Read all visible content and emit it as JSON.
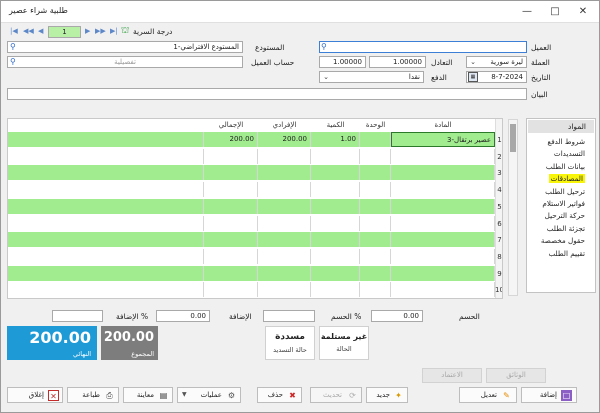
{
  "window": {
    "title": "طلبية شراء عصير"
  },
  "nav": {
    "page": "1",
    "approval_label": "درجة السرية"
  },
  "header": {
    "customer_label": "العميل",
    "customer_value": "",
    "warehouse_label": "المستودع",
    "warehouse_value": "1-المستودع الافتراضي",
    "currency_label": "العملة",
    "currency_value": "ليرة سورية",
    "rate_label": "التعادل",
    "rate_value": "1.00000",
    "rate_value2": "1.00000",
    "customer_account_label": "حساب العميل",
    "customer_account_placeholder": "تفصيلية",
    "date_label": "التاريخ",
    "date_value": "8-7-2024",
    "payment_label": "الدفع",
    "payment_value": "نقدا",
    "statement_label": "البيان",
    "statement_value": ""
  },
  "grid": {
    "columns": [
      "المادة",
      "الوحدة",
      "الكمية",
      "الإفرادي",
      "الإجمالي"
    ],
    "rows": [
      {
        "num": "1",
        "item": "3-عصير برتقال",
        "unit": "",
        "qty": "1.00",
        "price": "200.00",
        "total": "200.00"
      },
      {
        "num": "2"
      },
      {
        "num": "3"
      },
      {
        "num": "4"
      },
      {
        "num": "5"
      },
      {
        "num": "6"
      },
      {
        "num": "7"
      },
      {
        "num": "8"
      },
      {
        "num": "9"
      },
      {
        "num": "10"
      }
    ]
  },
  "side_panel": {
    "header": "المواد",
    "items": [
      "شروط الدفع",
      "التسديدات",
      "بيانات الطلب",
      "المصادقات",
      "ترحيل الطلب",
      "فواتير الاستلام",
      "حركة الترحيل",
      "تجزئة الطلب",
      "حقول مخصصة",
      "تقييم الطلب"
    ],
    "selected_index": 3
  },
  "totals": {
    "discount_label": "الحسم",
    "discount_value": "0.00",
    "discount_pct_label": "الحسم %",
    "discount_pct_value": "",
    "addition_label": "الإضافة",
    "addition_value": "0.00",
    "addition_pct_label": "الإضافة %",
    "addition_pct_value": ""
  },
  "cards": {
    "net_value": "200.00",
    "net_caption": "النهائي",
    "sum_value": "200.00",
    "sum_caption": "المجموع",
    "payment_status_value": "مسددة",
    "payment_status_caption": "حالة التسديد",
    "state_value": "غير مستلمة",
    "state_caption": "الحالة"
  },
  "secondary_buttons": {
    "documents": "الوثائق",
    "approve": "الاعتماد"
  },
  "toolbar": {
    "add": "إضافة",
    "edit": "تعديل",
    "new": "جديد",
    "update": "تحديث",
    "delete": "حذف",
    "operations": "عمليات",
    "preview": "معاينة",
    "print": "طباعة",
    "close": "إغلاق"
  },
  "colors": {
    "accent": "#1e9bd7",
    "grid_fill": "#a0ec8e",
    "selected_highlight": "#f8f40a",
    "sum_card": "#7d7d7d"
  }
}
